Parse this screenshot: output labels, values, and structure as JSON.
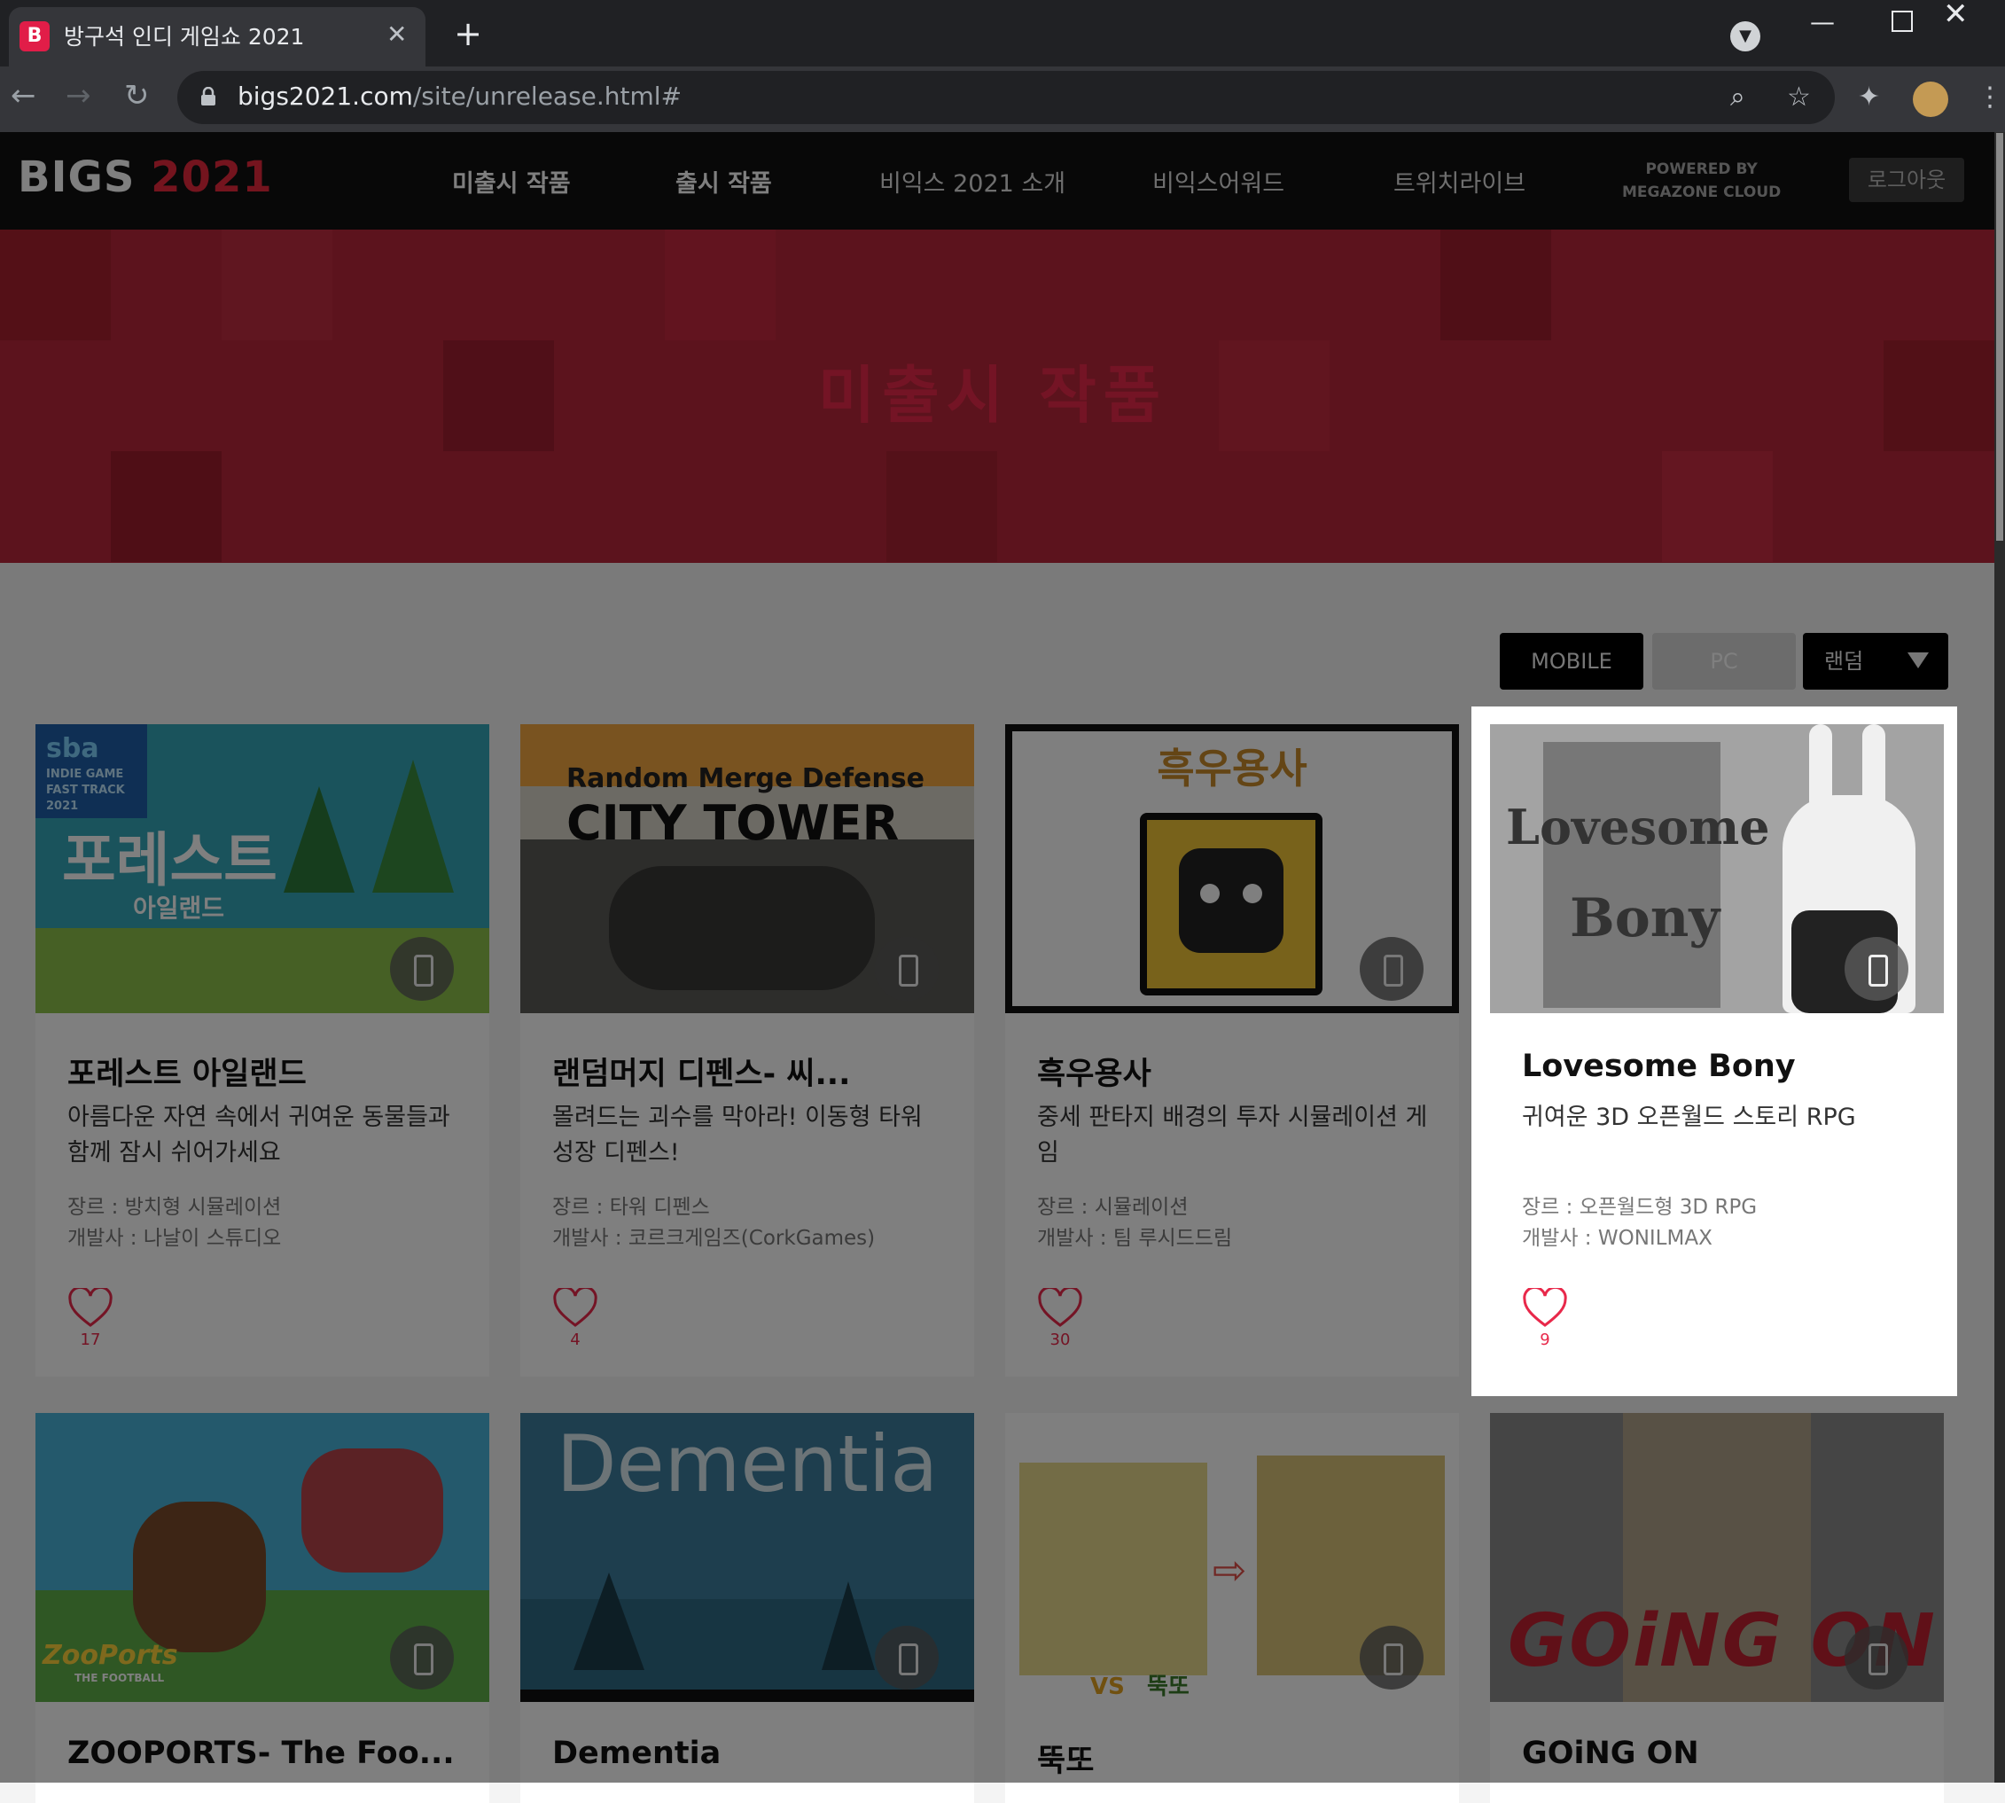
{
  "browser": {
    "tab_title": "방구석 인디 게임쇼 2021",
    "tab_favicon": "B",
    "url_host": "bigs2021.com",
    "url_path": "/site/unrelease.html#"
  },
  "site": {
    "logo_text": "BIGS",
    "logo_year": "2021",
    "nav": [
      "미출시 작품",
      "출시 작품",
      "비익스 2021 소개",
      "비익스어워드",
      "트위치라이브"
    ],
    "powered_by_line1": "POWERED BY",
    "powered_by_line2": "MEGAZONE CLOUD",
    "logout_label": "로그아웃"
  },
  "hero": {
    "title": "미출시 작품"
  },
  "filters": {
    "mobile": "MOBILE",
    "pc": "PC",
    "sort": "랜덤"
  },
  "cards": [
    {
      "title": "포레스트 아일랜드",
      "desc": "아름다운 자연 속에서 귀여운 동물들과 함께 잠시 쉬어가세요",
      "genre": "장르 : 방치형 시뮬레이션",
      "developer": "개발사 : 나날이 스튜디오",
      "likes": "17",
      "thumb_badge": "sba",
      "thumb_badge_sub": "INDIE GAME FAST TRACK 2021",
      "thumb_title": "포레스트",
      "thumb_sub": "아일랜드"
    },
    {
      "title": "랜덤머지 디펜스- 씨...",
      "desc": "몰려드는 괴수를 막아라! 이동형 타워 성장 디펜스!",
      "genre": "장르 : 타워 디펜스",
      "developer": "개발사 : 코르크게임즈(CorkGames)",
      "likes": "4",
      "thumb_line1": "Random Merge Defense",
      "thumb_line2": "CITY TOWER"
    },
    {
      "title": "흑우용사",
      "desc": "중세 판타지 배경의 투자 시뮬레이션 게임",
      "genre": "장르 : 시뮬레이션",
      "developer": "개발사 : 팀 루시드드림",
      "likes": "30",
      "thumb_title": "흑우용사"
    },
    {
      "title": "Lovesome Bony",
      "desc": "귀여운 3D 오픈월드 스토리 RPG",
      "genre": "장르 : 오픈월드형 3D RPG",
      "developer": "개발사 : WONILMAX",
      "likes": "9",
      "thumb_line1": "Lovesome",
      "thumb_line2": "Bony"
    }
  ],
  "cards_row2": [
    {
      "title": "ZOOPORTS- The Foo...",
      "thumb_text": "ZooPorts",
      "thumb_sub": "THE FOOTBALL"
    },
    {
      "title": "Dementia",
      "thumb_text": "Dementia"
    },
    {
      "title": "뚝또",
      "thumb_vs": "VS",
      "thumb_word": "뚝또"
    },
    {
      "title": "GOiNG ON",
      "thumb_text": "GOiNG ON"
    }
  ],
  "colors": {
    "accent": "#e8283c",
    "hero_bg": "#b8263a",
    "header_bg": "#111111"
  }
}
